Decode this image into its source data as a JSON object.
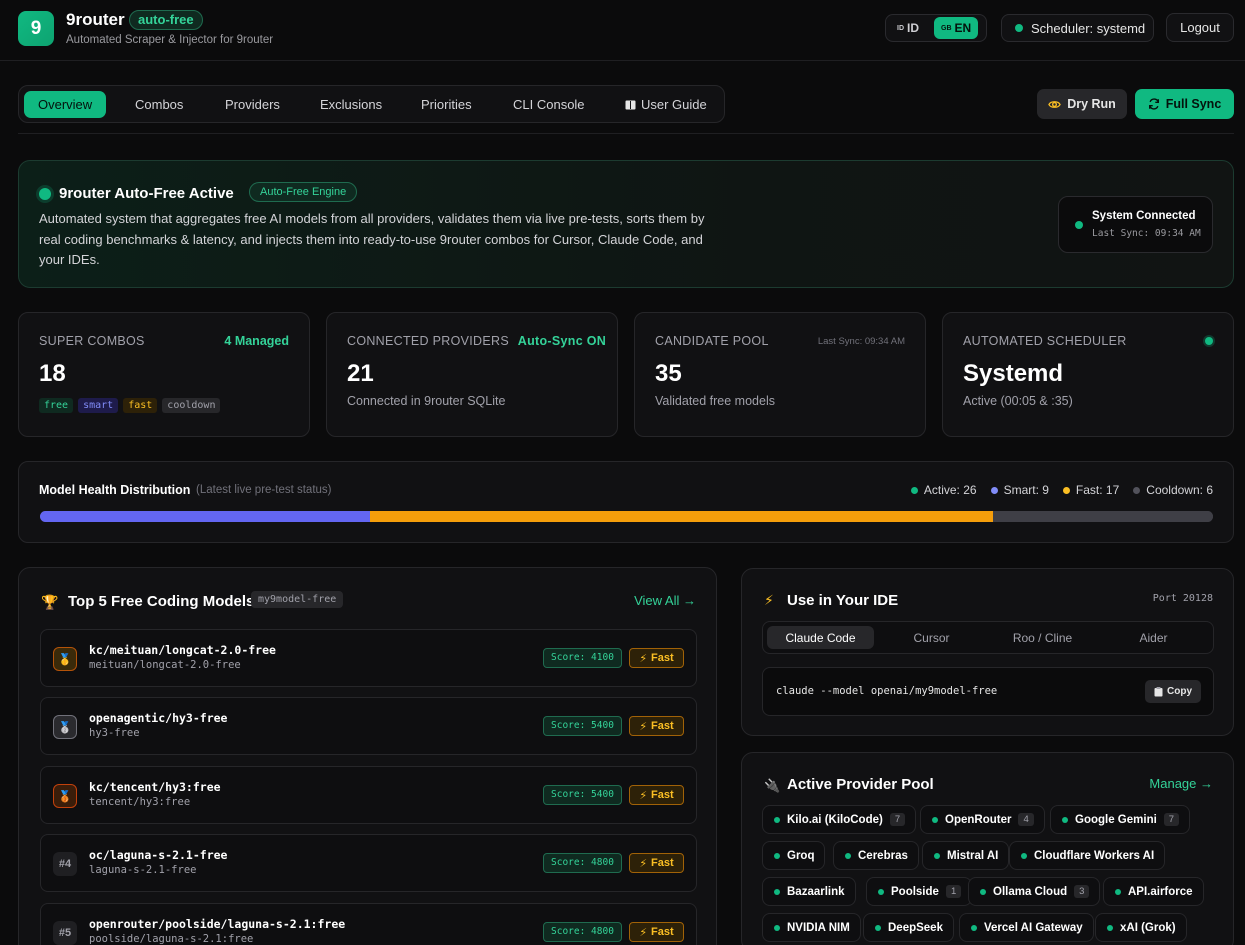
{
  "app": {
    "logo_text": "9",
    "title": "9router",
    "badge": "auto-free",
    "subtitle": "Automated Scraper & Injector for 9router"
  },
  "lang": {
    "id_flag": "ID",
    "id_label": "ID",
    "en_flag": "GB",
    "en_label": "EN",
    "active": "EN"
  },
  "scheduler_pill": "Scheduler: systemd",
  "logout_label": "Logout",
  "nav": {
    "tabs": [
      {
        "label": "Overview",
        "active": true
      },
      {
        "label": "Combos"
      },
      {
        "label": "Providers"
      },
      {
        "label": "Exclusions"
      },
      {
        "label": "Priorities"
      },
      {
        "label": "CLI Console"
      },
      {
        "label": "User Guide",
        "icon": "book-icon"
      }
    ],
    "dry_run_label": "Dry Run",
    "full_sync_label": "Full Sync"
  },
  "hero": {
    "title": "9router Auto-Free Active",
    "badge": "Auto-Free Engine",
    "description": "Automated system that aggregates free AI models from all providers, validates them via live pre-tests, sorts them by real coding benchmarks & latency, and injects them into ready-to-use 9router combos for Cursor, Claude Code, and your IDEs.",
    "status_title": "System Connected",
    "status_sub": "Last Sync: 09:34 AM"
  },
  "stats": {
    "super_combos": {
      "label": "SUPER COMBOS",
      "accent": "4 Managed",
      "value": "18",
      "chips": [
        "free",
        "smart",
        "fast",
        "cooldown"
      ]
    },
    "providers": {
      "label": "CONNECTED PROVIDERS",
      "accent": "Auto-Sync ON",
      "value": "21",
      "sub": "Connected in 9router SQLite"
    },
    "candidates": {
      "label": "CANDIDATE POOL",
      "right": "Last Sync: 09:34 AM",
      "value": "35",
      "sub": "Validated free models"
    },
    "scheduler": {
      "label": "AUTOMATED SCHEDULER",
      "value": "Systemd",
      "sub": "Active (00:05 & :35)"
    }
  },
  "health": {
    "title": "Model Health Distribution",
    "note": "(Latest live pre-test status)",
    "legend": [
      {
        "label": "Active: 26",
        "color": "#10b981"
      },
      {
        "label": "Smart: 9",
        "color": "#818cf8"
      },
      {
        "label": "Fast: 17",
        "color": "#fbbf24"
      },
      {
        "label": "Cooldown: 6",
        "color": "#52525b"
      }
    ],
    "segments": [
      {
        "name": "smart",
        "value": 9,
        "color": "#6366f1"
      },
      {
        "name": "fast",
        "value": 17,
        "color": "#f59e0b"
      },
      {
        "name": "cooldown",
        "value": 6,
        "color": "#3f3f46"
      }
    ]
  },
  "top_models": {
    "title": "Top 5 Free Coding Models",
    "tag": "my9model-free",
    "view_all": "View All →",
    "rows": [
      {
        "rank": "🥇",
        "rank_class": "gold",
        "name": "kc/meituan/longcat-2.0-free",
        "sub": "meituan/longcat-2.0-free",
        "score": "Score: 4100",
        "speed": "Fast"
      },
      {
        "rank": "🥈",
        "rank_class": "silver",
        "name": "openagentic/hy3-free",
        "sub": "hy3-free",
        "score": "Score: 5400",
        "speed": "Fast"
      },
      {
        "rank": "🥉",
        "rank_class": "bronze",
        "name": "kc/tencent/hy3:free",
        "sub": "tencent/hy3:free",
        "score": "Score: 5400",
        "speed": "Fast"
      },
      {
        "rank": "#4",
        "rank_class": "plain",
        "name": "oc/laguna-s-2.1-free",
        "sub": "laguna-s-2.1-free",
        "score": "Score: 4800",
        "speed": "Fast"
      },
      {
        "rank": "#5",
        "rank_class": "plain",
        "name": "openrouter/poolside/laguna-s-2.1:free",
        "sub": "poolside/laguna-s-2.1:free",
        "score": "Score: 4800",
        "speed": "Fast"
      }
    ]
  },
  "ide": {
    "title": "Use in Your IDE",
    "port": "Port 20128",
    "tabs": [
      "Claude Code",
      "Cursor",
      "Roo / Cline",
      "Aider"
    ],
    "active_tab": "Claude Code",
    "command": "claude --model openai/my9model-free",
    "copy_label": "Copy"
  },
  "pool": {
    "title": "Active Provider Pool",
    "manage": "Manage →",
    "providers": [
      {
        "name": "Kilo.ai (KiloCode)",
        "count": "7"
      },
      {
        "name": "OpenRouter",
        "count": "4"
      },
      {
        "name": "Google Gemini",
        "count": "7"
      },
      {
        "name": "Groq"
      },
      {
        "name": "Cerebras"
      },
      {
        "name": "Mistral AI"
      },
      {
        "name": "Cloudflare Workers AI"
      },
      {
        "name": "Bazaarlink"
      },
      {
        "name": "Poolside",
        "count": "1"
      },
      {
        "name": "Ollama Cloud",
        "count": "3"
      },
      {
        "name": "API.airforce"
      },
      {
        "name": "NVIDIA NIM"
      },
      {
        "name": "DeepSeek"
      },
      {
        "name": "Vercel AI Gateway"
      },
      {
        "name": "xAI (Grok)"
      }
    ]
  }
}
